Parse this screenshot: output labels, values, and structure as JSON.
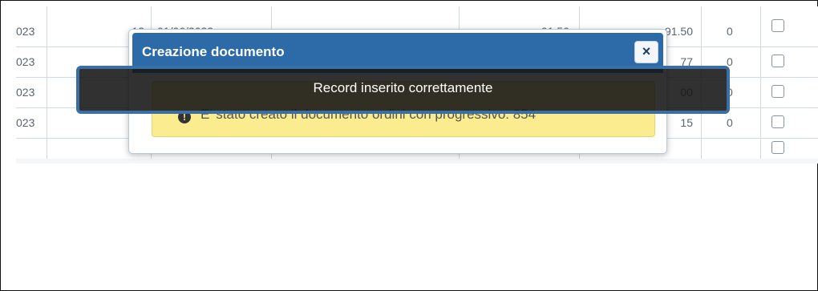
{
  "table": {
    "rows": [
      {
        "year": "023",
        "col2": "12",
        "date": "01/06/2023",
        "col4": "",
        "col5": "",
        "amount1": "91.50",
        "amount2": "91.50",
        "count": "0"
      },
      {
        "year": "023",
        "col2": "",
        "date": "",
        "col4": "",
        "col5": "",
        "amount1": "",
        "amount2": "77",
        "count": "0"
      },
      {
        "year": "023",
        "col2": "",
        "date": "",
        "col4": "",
        "col5": "",
        "amount1": "",
        "amount2": "00",
        "count": "0"
      },
      {
        "year": "023",
        "col2": "",
        "date": "",
        "col4": "",
        "col5": "",
        "amount1": "",
        "amount2": "15",
        "count": "0"
      }
    ]
  },
  "modal": {
    "title": "Creazione documento",
    "close_label": "×",
    "alert_icon": "info-circle-icon",
    "alert_text": "E' stato creato il documento ordini con progressivo: 854"
  },
  "toast": {
    "message": "Record inserito correttamente"
  },
  "colors": {
    "modal_header": "#2c6aa8",
    "alert_bg": "#fbed8f",
    "toast_bg": "#141414",
    "toast_border": "#3a6fa4"
  }
}
